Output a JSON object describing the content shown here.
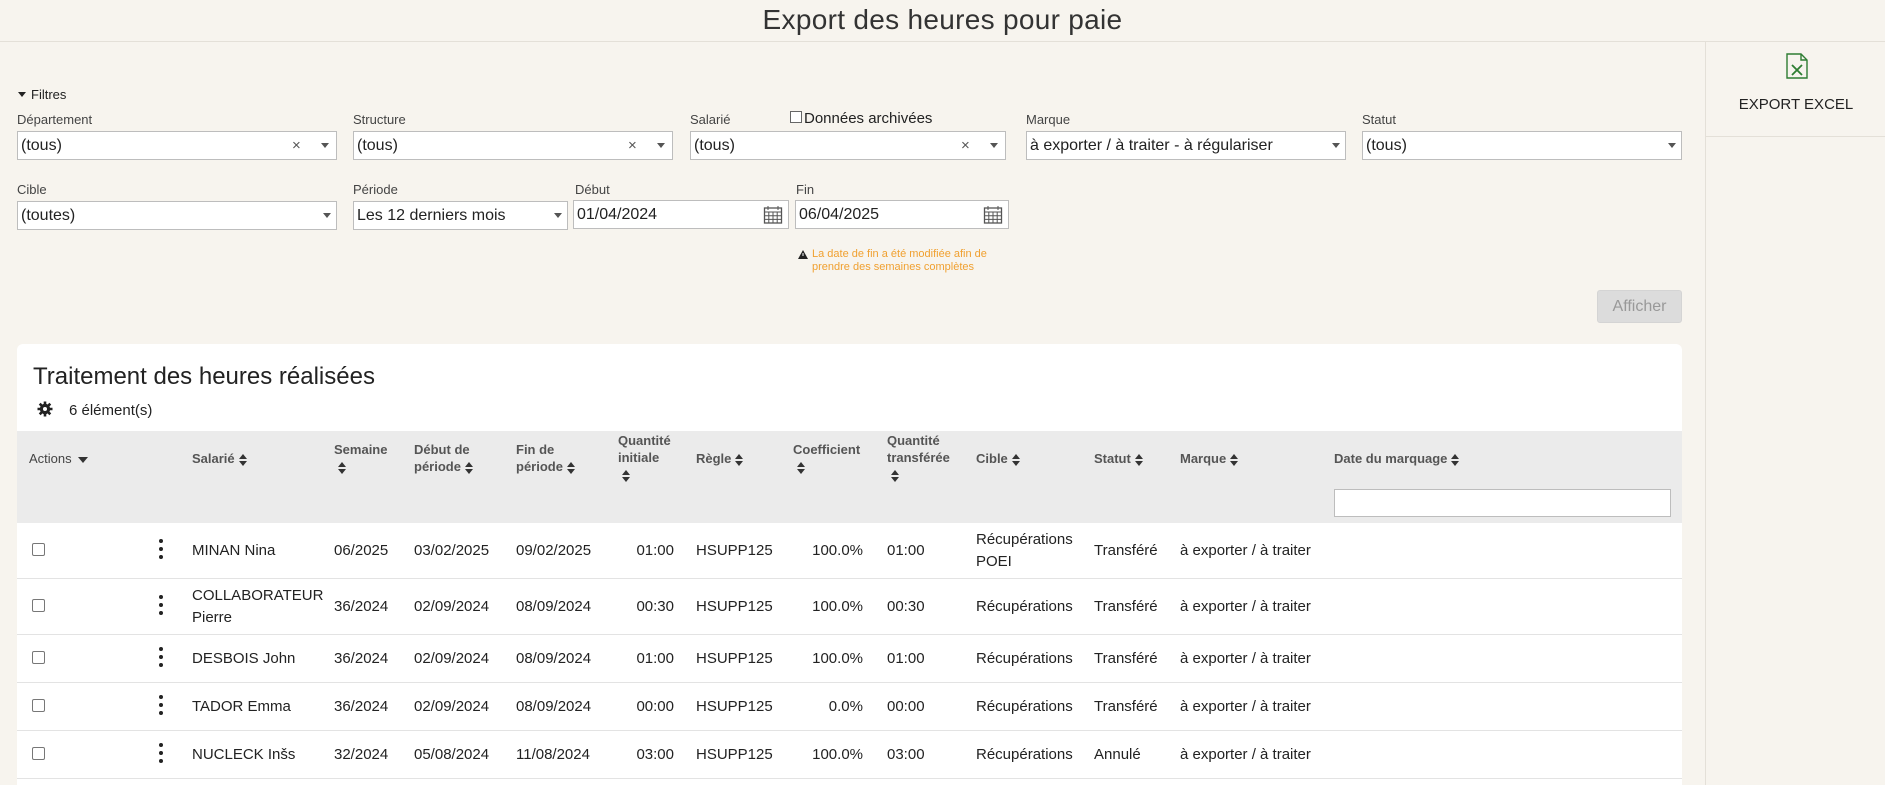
{
  "page": {
    "title": "Export des heures pour paie"
  },
  "export": {
    "label": "EXPORT EXCEL",
    "icon": "excel-file-icon"
  },
  "filters": {
    "toggle_label": "Filtres",
    "departement": {
      "label": "Département",
      "value": "(tous)"
    },
    "structure": {
      "label": "Structure",
      "value": "(tous)"
    },
    "salarie": {
      "label": "Salarié",
      "value": "(tous)"
    },
    "archive_label": "Données archivées",
    "marque": {
      "label": "Marque",
      "value": "à exporter / à traiter - à régulariser"
    },
    "statut": {
      "label": "Statut",
      "value": "(tous)"
    },
    "cible": {
      "label": "Cible",
      "value": "(toutes)"
    },
    "periode": {
      "label": "Période",
      "value": "Les 12 derniers mois"
    },
    "debut": {
      "label": "Début",
      "value": "01/04/2024"
    },
    "fin": {
      "label": "Fin",
      "value": "06/04/2025"
    },
    "warning_line1": "La date de fin a été modifiée afin de",
    "warning_line2": "prendre des semaines complètes",
    "show_button": "Afficher"
  },
  "table": {
    "title": "Traitement des heures réalisées",
    "count": "6 élément(s)",
    "headers": {
      "actions": "Actions",
      "salarie": "Salarié",
      "semaine": "Semaine",
      "debut_l1": "Début de",
      "debut_l2": "période",
      "fin_l1": "Fin de",
      "fin_l2": "période",
      "qte_l1": "Quantité",
      "qte_l2": "initiale",
      "regle": "Règle",
      "coef": "Coefficient",
      "qtt_l1": "Quantité",
      "qtt_l2": "transférée",
      "cible": "Cible",
      "statut": "Statut",
      "marque": "Marque",
      "date_marquage": "Date du marquage"
    },
    "rows": [
      {
        "salarie_l1": "MINAN Nina",
        "salarie_l2": "",
        "semaine": "06/2025",
        "debut": "03/02/2025",
        "fin": "09/02/2025",
        "qte": "01:00",
        "regle": "HSUPP125",
        "coef": "100.0%",
        "qtt": "01:00",
        "cible_l1": "Récupérations",
        "cible_l2": "POEI",
        "statut": "Transféré",
        "marque": "à exporter / à traiter",
        "date": ""
      },
      {
        "salarie_l1": "COLLABORATEUR",
        "salarie_l2": "Pierre",
        "semaine": "36/2024",
        "debut": "02/09/2024",
        "fin": "08/09/2024",
        "qte": "00:30",
        "regle": "HSUPP125",
        "coef": "100.0%",
        "qtt": "00:30",
        "cible_l1": "Récupérations",
        "cible_l2": "",
        "statut": "Transféré",
        "marque": "à exporter / à traiter",
        "date": ""
      },
      {
        "salarie_l1": "DESBOIS John",
        "salarie_l2": "",
        "semaine": "36/2024",
        "debut": "02/09/2024",
        "fin": "08/09/2024",
        "qte": "01:00",
        "regle": "HSUPP125",
        "coef": "100.0%",
        "qtt": "01:00",
        "cible_l1": "Récupérations",
        "cible_l2": "",
        "statut": "Transféré",
        "marque": "à exporter / à traiter",
        "date": ""
      },
      {
        "salarie_l1": "TADOR Emma",
        "salarie_l2": "",
        "semaine": "36/2024",
        "debut": "02/09/2024",
        "fin": "08/09/2024",
        "qte": "00:00",
        "regle": "HSUPP125",
        "coef": "0.0%",
        "qtt": "00:00",
        "cible_l1": "Récupérations",
        "cible_l2": "",
        "statut": "Transféré",
        "marque": "à exporter / à traiter",
        "date": ""
      },
      {
        "salarie_l1": "NUCLECK Inšs",
        "salarie_l2": "",
        "semaine": "32/2024",
        "debut": "05/08/2024",
        "fin": "11/08/2024",
        "qte": "03:00",
        "regle": "HSUPP125",
        "coef": "100.0%",
        "qtt": "03:00",
        "cible_l1": "Récupérations",
        "cible_l2": "",
        "statut": "Annulé",
        "marque": "à exporter / à traiter",
        "date": ""
      }
    ]
  },
  "colors": {
    "accent_excel": "#2e7d32",
    "warning": "#f0a030",
    "header_bg": "#ebebeb",
    "page_bg": "#f7f4ee"
  }
}
